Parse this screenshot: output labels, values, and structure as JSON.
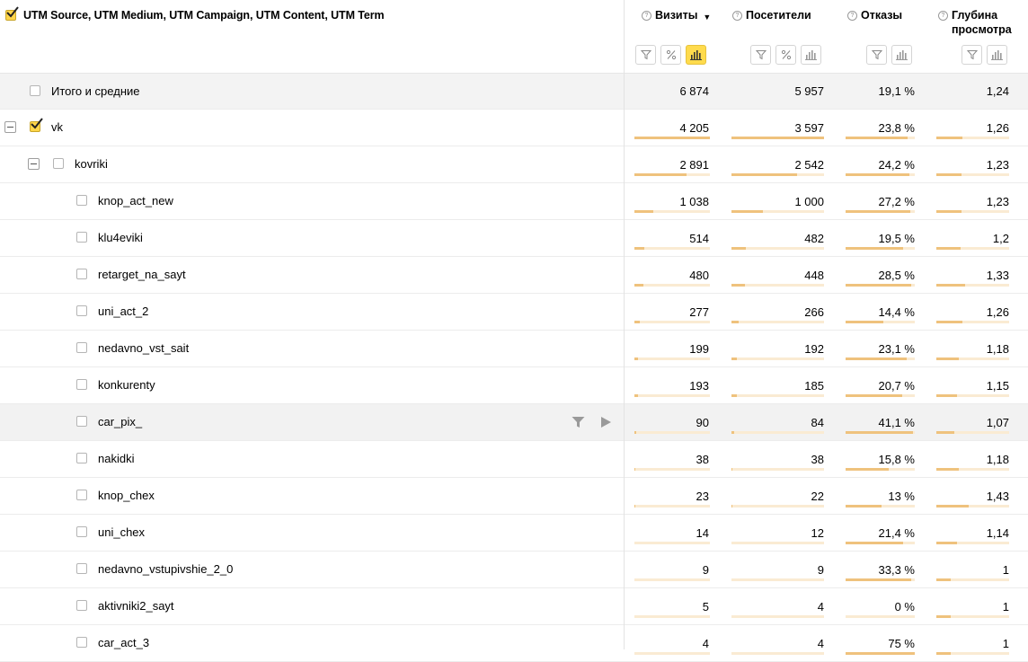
{
  "header": {
    "dimension_title": "UTM Source, UTM Medium, UTM Campaign, UTM Content, UTM Term",
    "help_glyph": "?",
    "sort_glyph": "▼",
    "metrics": [
      {
        "label": "Визиты"
      },
      {
        "label": "Посетители"
      },
      {
        "label": "Отказы"
      },
      {
        "label": "Глубина просмотра"
      }
    ]
  },
  "total": {
    "label": "Итого и средние",
    "values": [
      "6 874",
      "5 957",
      "19,1 %",
      "1,24"
    ]
  },
  "rows": [
    {
      "label": "vk",
      "level": 0,
      "checked": true,
      "expanded": true,
      "values": [
        "4 205",
        "3 597",
        "23,8 %",
        "1,26"
      ],
      "fractions": [
        1.0,
        1.0,
        0.9,
        0.36
      ]
    },
    {
      "label": "kovriki",
      "level": 1,
      "checked": false,
      "expanded": true,
      "values": [
        "2 891",
        "2 542",
        "24,2 %",
        "1,23"
      ],
      "fractions": [
        0.69,
        0.71,
        0.92,
        0.35
      ]
    },
    {
      "label": "knop_act_new",
      "level": 2,
      "checked": false,
      "values": [
        "1 038",
        "1 000",
        "27,2 %",
        "1,23"
      ],
      "fractions": [
        0.25,
        0.34,
        0.93,
        0.35
      ]
    },
    {
      "label": "klu4eviki",
      "level": 2,
      "checked": false,
      "values": [
        "514",
        "482",
        "19,5 %",
        "1,2"
      ],
      "fractions": [
        0.13,
        0.16,
        0.83,
        0.33
      ]
    },
    {
      "label": "retarget_na_sayt",
      "level": 2,
      "checked": false,
      "values": [
        "480",
        "448",
        "28,5 %",
        "1,33"
      ],
      "fractions": [
        0.12,
        0.15,
        0.95,
        0.4
      ]
    },
    {
      "label": "uni_act_2",
      "level": 2,
      "checked": false,
      "values": [
        "277",
        "266",
        "14,4 %",
        "1,26"
      ],
      "fractions": [
        0.07,
        0.08,
        0.55,
        0.36
      ]
    },
    {
      "label": "nedavno_vst_sait",
      "level": 2,
      "checked": false,
      "values": [
        "199",
        "192",
        "23,1 %",
        "1,18"
      ],
      "fractions": [
        0.05,
        0.06,
        0.88,
        0.31
      ]
    },
    {
      "label": "konkurenty",
      "level": 2,
      "checked": false,
      "values": [
        "193",
        "185",
        "20,7 %",
        "1,15"
      ],
      "fractions": [
        0.05,
        0.06,
        0.82,
        0.29
      ]
    },
    {
      "label": "car_pix_",
      "level": 2,
      "checked": false,
      "hover": true,
      "values": [
        "90",
        "84",
        "41,1 %",
        "1,07"
      ],
      "fractions": [
        0.02,
        0.03,
        0.98,
        0.25
      ]
    },
    {
      "label": "nakidki",
      "level": 2,
      "checked": false,
      "values": [
        "38",
        "38",
        "15,8 %",
        "1,18"
      ],
      "fractions": [
        0.01,
        0.01,
        0.62,
        0.31
      ]
    },
    {
      "label": "knop_chex",
      "level": 2,
      "checked": false,
      "values": [
        "23",
        "22",
        "13 %",
        "1,43"
      ],
      "fractions": [
        0.01,
        0.01,
        0.52,
        0.45
      ]
    },
    {
      "label": "uni_chex",
      "level": 2,
      "checked": false,
      "values": [
        "14",
        "12",
        "21,4 %",
        "1,14"
      ],
      "fractions": [
        0.0,
        0.0,
        0.83,
        0.28
      ]
    },
    {
      "label": "nedavno_vstupivshie_2_0",
      "level": 2,
      "checked": false,
      "values": [
        "9",
        "9",
        "33,3 %",
        "1"
      ],
      "fractions": [
        0.0,
        0.0,
        0.95,
        0.2
      ]
    },
    {
      "label": "aktivniki2_sayt",
      "level": 2,
      "checked": false,
      "values": [
        "5",
        "4",
        "0 %",
        "1"
      ],
      "fractions": [
        0.0,
        0.0,
        0.0,
        0.2
      ]
    },
    {
      "label": "car_act_3",
      "level": 2,
      "checked": false,
      "values": [
        "4",
        "4",
        "75 %",
        "1"
      ],
      "fractions": [
        0.0,
        0.0,
        1.0,
        0.2
      ]
    }
  ],
  "colors": {
    "accent": "#ffdb4d",
    "bar_fill": "#efc27d",
    "bar_track": "#faebd3"
  }
}
